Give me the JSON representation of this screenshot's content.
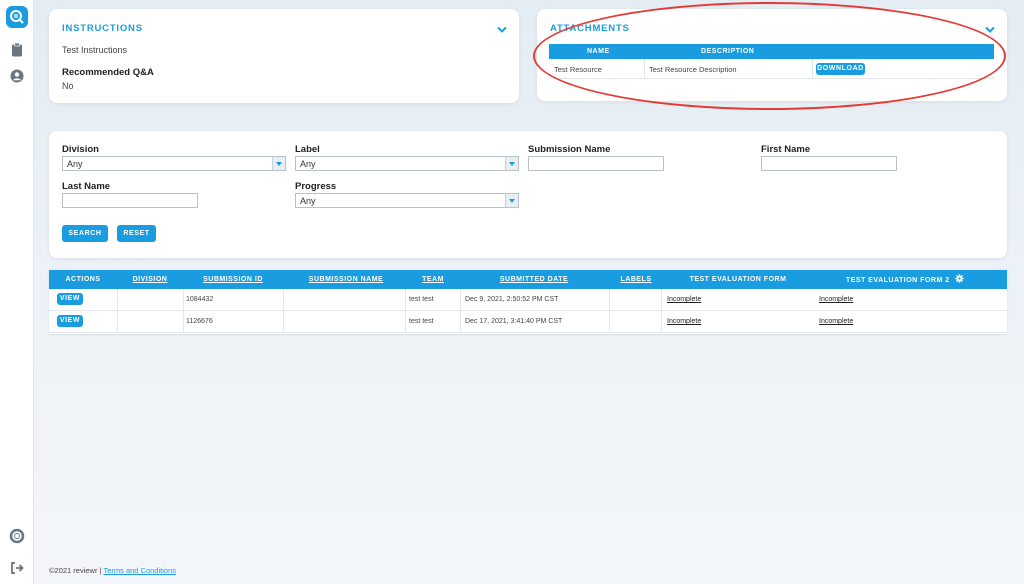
{
  "colors": {
    "accent": "#1a9de0",
    "annotation": "#e53935"
  },
  "sidebar": {
    "icons": [
      "search-logo-icon",
      "clipboard-icon",
      "user-circle-icon",
      "help-lifebuoy-icon",
      "logout-icon"
    ]
  },
  "instructions": {
    "title": "INSTRUCTIONS",
    "text": "Test Instructions",
    "recommended_label": "Recommended Q&A",
    "recommended_value": "No"
  },
  "attachments": {
    "title": "ATTACHMENTS",
    "columns": [
      "NAME",
      "DESCRIPTION"
    ],
    "rows": [
      {
        "name": "Test Resource",
        "description": "Test Resource Description",
        "action": "DOWNLOAD"
      }
    ]
  },
  "filters": {
    "division": {
      "label": "Division",
      "value": "Any"
    },
    "label": {
      "label": "Label",
      "value": "Any"
    },
    "submission_name": {
      "label": "Submission Name",
      "value": ""
    },
    "first_name": {
      "label": "First Name",
      "value": ""
    },
    "last_name": {
      "label": "Last Name",
      "value": ""
    },
    "progress": {
      "label": "Progress",
      "value": "Any"
    },
    "search_label": "SEARCH",
    "reset_label": "RESET"
  },
  "table": {
    "columns": [
      "ACTIONS",
      "DIVISION",
      "SUBMISSION ID",
      "SUBMISSION NAME",
      "TEAM",
      "SUBMITTED DATE",
      "LABELS",
      "TEST EVALUATION FORM",
      "TEST EVALUATION FORM 2"
    ],
    "rows": [
      {
        "action": "VIEW",
        "division": "",
        "submission_id": "1084432",
        "submission_name": "",
        "team": "test test",
        "submitted_date": "Dec 9, 2021, 2:50:52 PM CST",
        "labels": "",
        "form1": "Incomplete",
        "form2": "Incomplete"
      },
      {
        "action": "VIEW",
        "division": "",
        "submission_id": "1126676",
        "submission_name": "",
        "team": "test test",
        "submitted_date": "Dec 17, 2021, 3:41:40 PM CST",
        "labels": "",
        "form1": "Incomplete",
        "form2": "Incomplete"
      }
    ]
  },
  "footer": {
    "copyright": "©2021 reviewr |",
    "terms_link": "Terms and Conditions"
  }
}
